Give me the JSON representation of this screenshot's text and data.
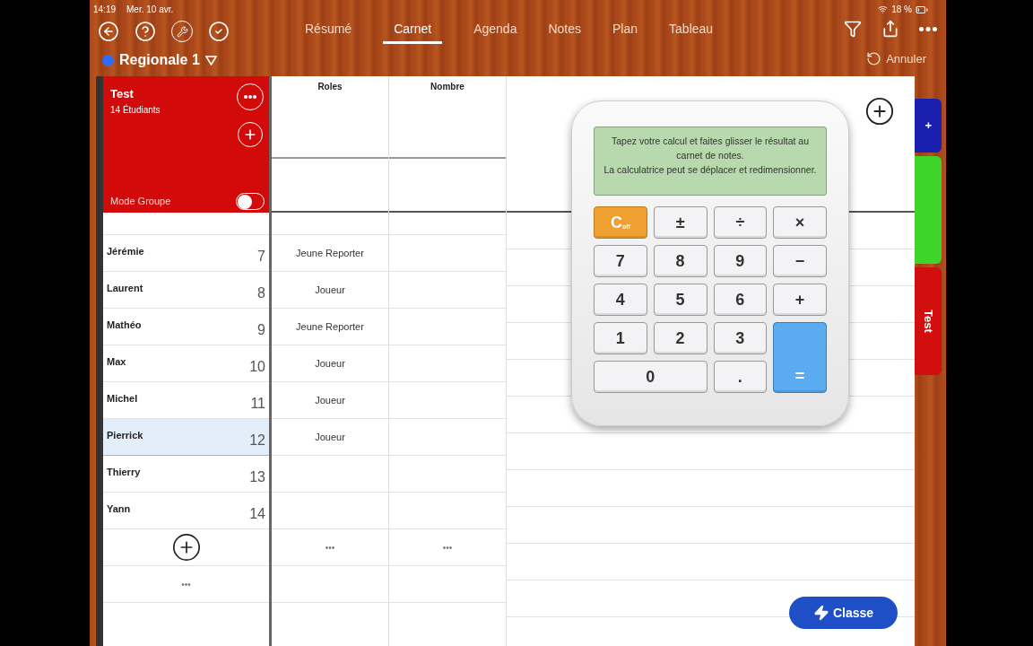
{
  "status_bar": {
    "time": "14:19",
    "date": "Mer. 10 avr.",
    "battery": "18 %"
  },
  "tabs": [
    {
      "label": "Résumé",
      "selected": false
    },
    {
      "label": "Carnet",
      "selected": true
    },
    {
      "label": "Agenda",
      "selected": false
    },
    {
      "label": "Notes",
      "selected": false
    },
    {
      "label": "Plan",
      "selected": false
    },
    {
      "label": "Tableau",
      "selected": false
    }
  ],
  "class_selector": {
    "label": "Regionale 1",
    "color": "#2f6bff"
  },
  "undo_button": "Annuler",
  "group": {
    "title": "Test",
    "subtitle": "14 Étudiants",
    "mode_label": "Mode Groupe",
    "mode_on": false
  },
  "columns": [
    "Roles",
    "Nombre"
  ],
  "students": [
    {
      "name": "Jérémie",
      "number": "7",
      "role": "Jeune Reporter",
      "selected": false
    },
    {
      "name": "Laurent",
      "number": "8",
      "role": "Joueur",
      "selected": false
    },
    {
      "name": "Mathéo",
      "number": "9",
      "role": "Jeune Reporter",
      "selected": false
    },
    {
      "name": "Max",
      "number": "10",
      "role": "Joueur",
      "selected": false
    },
    {
      "name": "Michel",
      "number": "11",
      "role": "Joueur",
      "selected": false
    },
    {
      "name": "Pierrick",
      "number": "12",
      "role": "Joueur",
      "selected": true
    },
    {
      "name": "Thierry",
      "number": "13",
      "selected": false
    },
    {
      "name": "Yann",
      "number": "14",
      "selected": false
    }
  ],
  "more_label": "•••",
  "column_more": [
    "•••",
    "•••"
  ],
  "calculator": {
    "display": "Tapez votre calcul et faites glisser le résultat au carnet de notes.\nLa calculatrice peut se déplacer et redimensionner.",
    "keys": [
      {
        "label": "C$_{off}$",
        "kind": "clear"
      },
      {
        "label": "±",
        "kind": "key"
      },
      {
        "label": "÷",
        "kind": "key"
      },
      {
        "label": "×",
        "kind": "key"
      },
      {
        "label": "7",
        "kind": "key"
      },
      {
        "label": "8",
        "kind": "key"
      },
      {
        "label": "9",
        "kind": "key"
      },
      {
        "label": "−",
        "kind": "key"
      },
      {
        "label": "4",
        "kind": "key"
      },
      {
        "label": "5",
        "kind": "key"
      },
      {
        "label": "6",
        "kind": "key"
      },
      {
        "label": "+",
        "kind": "key"
      },
      {
        "label": "1",
        "kind": "key"
      },
      {
        "label": "2",
        "kind": "key"
      },
      {
        "label": "3",
        "kind": "key"
      },
      {
        "label": "0",
        "kind": "wide"
      },
      {
        "label": ".",
        "kind": "key"
      },
      {
        "label": "=",
        "kind": "equals"
      }
    ]
  },
  "side_tabs": [
    {
      "label": "+",
      "color": "#1a1fb0"
    },
    {
      "color": "#3ed42a"
    },
    {
      "label": "Test",
      "color": "#d10f0f"
    }
  ],
  "classe_button": "Classe"
}
